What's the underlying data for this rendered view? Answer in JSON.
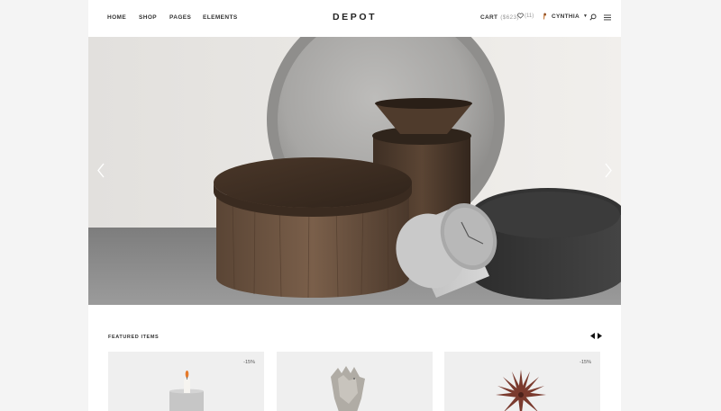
{
  "header": {
    "nav": [
      "HOME",
      "SHOP",
      "PAGES",
      "ELEMENTS"
    ],
    "logo": "DEPOT",
    "cart_label": "CART",
    "cart_amount": "($623)",
    "wishlist_count": "(11)",
    "user_name": "CYNTHIA"
  },
  "hero": {
    "icons": {
      "prev": "chevron-left-icon",
      "next": "chevron-right-icon"
    }
  },
  "featured": {
    "title": "FEATURED ITEMS",
    "products": [
      {
        "badge": "-15%",
        "image": "candle-image"
      },
      {
        "badge": "",
        "image": "rooster-figurine-image"
      },
      {
        "badge": "-15%",
        "image": "star-clock-image"
      }
    ]
  },
  "colors": {
    "accent": "#222222",
    "background": "#f4f4f4",
    "card": "#efefef"
  }
}
